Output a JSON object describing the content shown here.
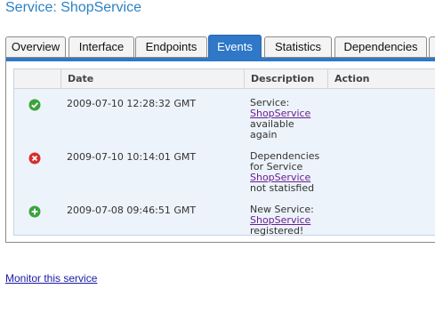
{
  "page_title": "Service: ShopService",
  "tabs": [
    {
      "label": "Overview",
      "active": false
    },
    {
      "label": "Interface",
      "active": false
    },
    {
      "label": "Endpoints",
      "active": false
    },
    {
      "label": "Events",
      "active": true
    },
    {
      "label": "Statistics",
      "active": false
    },
    {
      "label": "Dependencies",
      "active": false
    }
  ],
  "events_table": {
    "columns": [
      "Date",
      "Description",
      "Action"
    ],
    "rows": [
      {
        "status_icon": "check-circle-icon",
        "status_color": "#3ca33c",
        "date": "2009-07-10 12:28:32 GMT",
        "desc_before": "Service:",
        "desc_link": "ShopService",
        "desc_after_1": "available",
        "desc_after_2": "again"
      },
      {
        "status_icon": "error-x-circle-icon",
        "status_color": "#d62f2f",
        "date": "2009-07-10 10:14:01 GMT",
        "desc_before_1": "Dependencies",
        "desc_before_2": "for Service",
        "desc_link": "ShopService",
        "desc_after_1": "not statisfied"
      },
      {
        "status_icon": "plus-circle-icon",
        "status_color": "#3ca33c",
        "date": "2009-07-08 09:46:51 GMT",
        "desc_before": "New Service:",
        "desc_link": "ShopService",
        "desc_after_1": "registered!"
      }
    ]
  },
  "monitor_link": "Monitor this service",
  "colors": {
    "title": "#2b82c5",
    "active_tab": "#2f78c7",
    "link": "#6b1f91",
    "grid_bg": "#edf3fa"
  }
}
